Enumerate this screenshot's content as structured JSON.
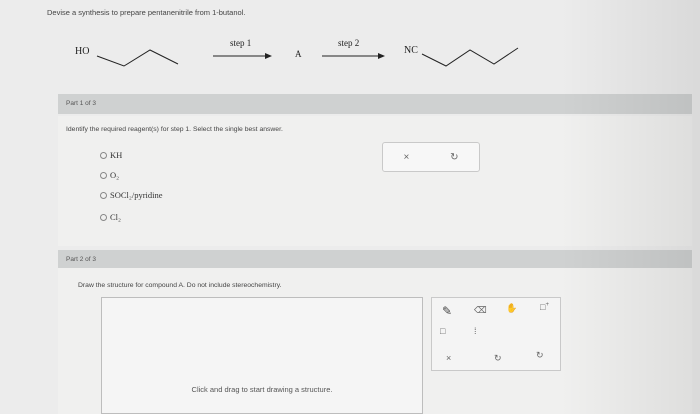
{
  "question": "Devise a synthesis to prepare pentanenitrile from 1-butanol.",
  "scheme": {
    "reactant": "HO",
    "step1": "step 1",
    "intermediate": "A",
    "step2": "step 2",
    "product": "NC"
  },
  "part1": {
    "header": "Part 1 of 3",
    "instruction": "Identify the required reagent(s) for step 1. Select the single best answer.",
    "options": [
      "KH",
      "O₂",
      "SOCl₂/pyridine",
      "Cl₂"
    ],
    "answer_buttons": {
      "clear": "×",
      "undo": "↻"
    }
  },
  "part2": {
    "header": "Part 2 of 3",
    "instruction": "Draw the structure for compound A. Do not include stereochemistry.",
    "canvas_hint": "Click and drag to start drawing a structure.",
    "toolbar": {
      "pencil": "✎",
      "eraser": "⌫",
      "hand": "✋",
      "plus": "+",
      "clear": "×",
      "undo": "↻",
      "redo": "↻"
    }
  }
}
